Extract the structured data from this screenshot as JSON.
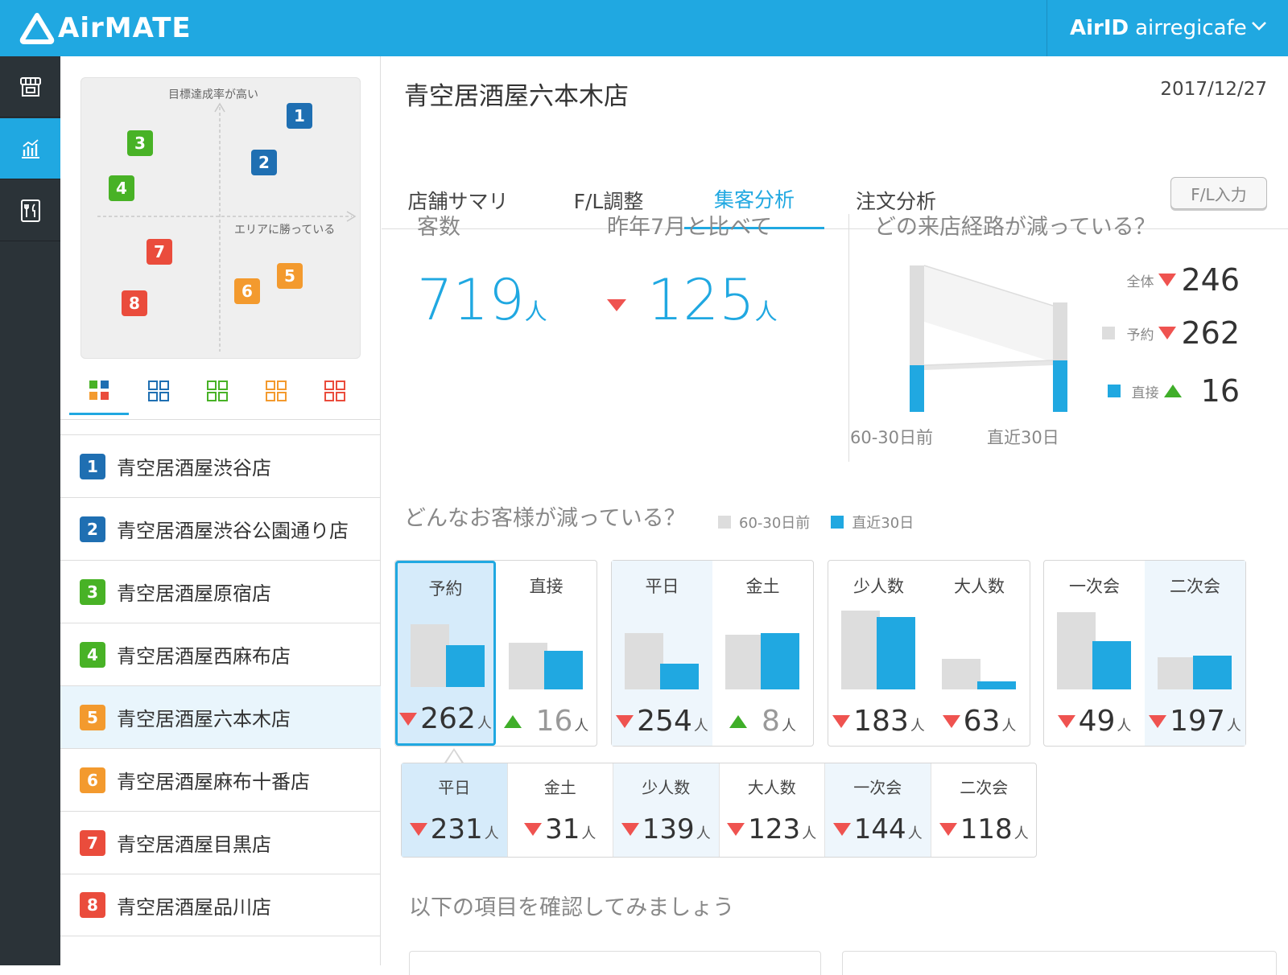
{
  "app": {
    "logo_text": "AirMATE"
  },
  "account": {
    "prefix": "AirID",
    "user": "airregicafe"
  },
  "nav_rail": [
    {
      "name": "store-icon"
    },
    {
      "name": "analytics-icon"
    },
    {
      "name": "menu-book-icon"
    }
  ],
  "matrix": {
    "y_label": "目標達成率が高い",
    "x_label": "エリアに勝っている",
    "points": [
      {
        "n": "1",
        "color": "#1f6fb2"
      },
      {
        "n": "2",
        "color": "#1f6fb2"
      },
      {
        "n": "3",
        "color": "#48b226"
      },
      {
        "n": "4",
        "color": "#48b226"
      },
      {
        "n": "5",
        "color": "#f39a2e"
      },
      {
        "n": "6",
        "color": "#f39a2e"
      },
      {
        "n": "7",
        "color": "#ea4c3c"
      },
      {
        "n": "8",
        "color": "#ea4c3c"
      }
    ]
  },
  "filters": [
    {
      "name": "filter-all-icon",
      "colors": [
        "#48b226",
        "#1f6fb2",
        "#f39a2e",
        "#ea4c3c"
      ],
      "filled": true
    },
    {
      "name": "filter-blue-icon",
      "colors": [
        "#1f6fb2"
      ],
      "filled": false
    },
    {
      "name": "filter-green-icon",
      "colors": [
        "#48b226"
      ],
      "filled": false
    },
    {
      "name": "filter-orange-icon",
      "colors": [
        "#f39a2e"
      ],
      "filled": false
    },
    {
      "name": "filter-red-icon",
      "colors": [
        "#ea4c3c"
      ],
      "filled": false
    }
  ],
  "stores": [
    {
      "n": "1",
      "name": "青空居酒屋渋谷店",
      "color": "#1f6fb2"
    },
    {
      "n": "2",
      "name": "青空居酒屋渋谷公園通り店",
      "color": "#1f6fb2"
    },
    {
      "n": "3",
      "name": "青空居酒屋原宿店",
      "color": "#48b226"
    },
    {
      "n": "4",
      "name": "青空居酒屋西麻布店",
      "color": "#48b226"
    },
    {
      "n": "5",
      "name": "青空居酒屋六本木店",
      "color": "#f39a2e"
    },
    {
      "n": "6",
      "name": "青空居酒屋麻布十番店",
      "color": "#f39a2e"
    },
    {
      "n": "7",
      "name": "青空居酒屋目黒店",
      "color": "#ea4c3c"
    },
    {
      "n": "8",
      "name": "青空居酒屋品川店",
      "color": "#ea4c3c"
    }
  ],
  "main": {
    "title": "青空居酒屋六本木店",
    "date": "2017/12/27",
    "tabs": [
      "店舗サマリ",
      "F/L調整",
      "集客分析",
      "注文分析"
    ],
    "fl_button": "F/L入力"
  },
  "kpi": {
    "visitors_label": "客数",
    "visitors_value": "719",
    "visitors_unit": "人",
    "compare_label": "昨年7月と比べて",
    "compare_value": "125",
    "compare_unit": "人"
  },
  "route": {
    "title": "どの来店経路が減っている？",
    "x_labels": [
      "60-30日前",
      "直近30日"
    ],
    "legend": [
      {
        "label": "全体",
        "dir": "down",
        "value": "246"
      },
      {
        "label": "予約",
        "dir": "down",
        "value": "262"
      },
      {
        "label": "直接",
        "dir": "up",
        "value": "16"
      }
    ]
  },
  "customers": {
    "title": "どんなお客様が減っている？",
    "legend_prev": "60-30日前",
    "legend_recent": "直近30日",
    "unit": "人",
    "cards": [
      [
        {
          "title": "予約",
          "dir": "down",
          "value": "262"
        },
        {
          "title": "直接",
          "dir": "up",
          "value": "16"
        }
      ],
      [
        {
          "title": "平日",
          "dir": "down",
          "value": "254"
        },
        {
          "title": "金土",
          "dir": "up",
          "value": "8"
        }
      ],
      [
        {
          "title": "少人数",
          "dir": "down",
          "value": "183"
        },
        {
          "title": "大人数",
          "dir": "down",
          "value": "63"
        }
      ],
      [
        {
          "title": "一次会",
          "dir": "down",
          "value": "49"
        },
        {
          "title": "二次会",
          "dir": "down",
          "value": "197"
        }
      ]
    ],
    "breakdown": [
      {
        "title": "平日",
        "value": "231"
      },
      {
        "title": "金土",
        "value": "31"
      },
      {
        "title": "少人数",
        "value": "139"
      },
      {
        "title": "大人数",
        "value": "123"
      },
      {
        "title": "一次会",
        "value": "144"
      },
      {
        "title": "二次会",
        "value": "118"
      }
    ]
  },
  "check": {
    "title": "以下の項目を確認してみましょう"
  },
  "colors": {
    "accent": "#20a8e1",
    "prev_bar": "#dddddd",
    "down": "#ef5350",
    "up": "#3fae29"
  }
}
